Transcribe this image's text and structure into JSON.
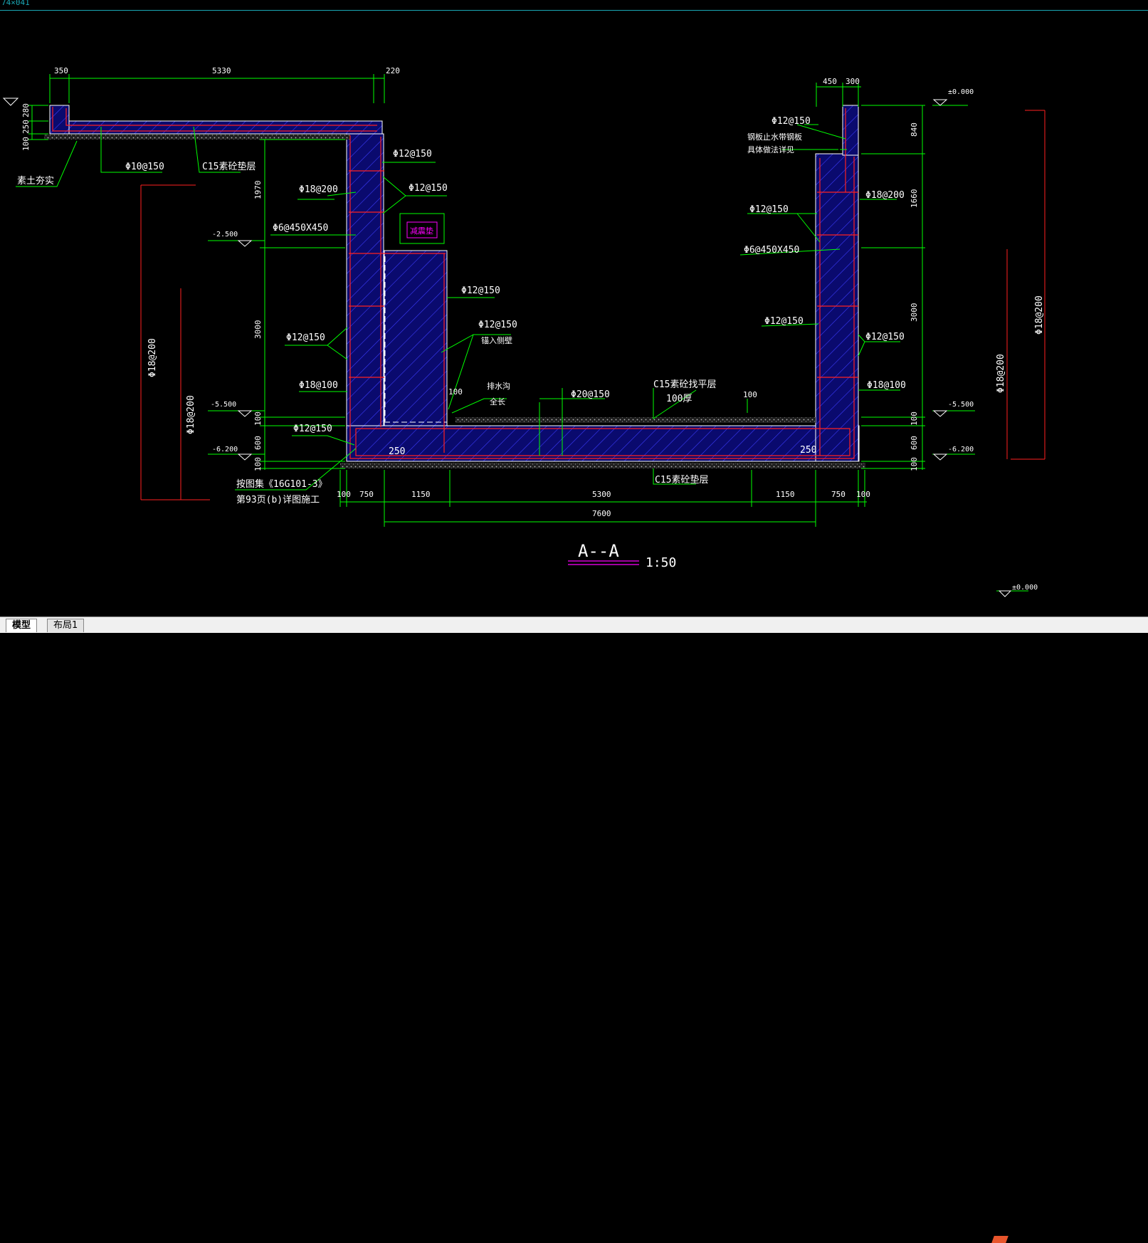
{
  "top_label": "74×041",
  "tabs": {
    "model": "模型",
    "layout": "布局1"
  },
  "section": {
    "title": "A--A",
    "scale": "1:50"
  },
  "dims_top": [
    "350",
    "5330",
    "220"
  ],
  "dims_top_right": [
    "450",
    "300"
  ],
  "dims_bottom": [
    "100",
    "750",
    "1150",
    "5300",
    "1150",
    "750",
    "100"
  ],
  "dim_total": "7600",
  "dims_left_vertical": [
    "280",
    "250",
    "100",
    "1970",
    "3000",
    "100",
    "600",
    "100"
  ],
  "dims_right_vertical": [
    "840",
    "1660",
    "3000",
    "100",
    "600",
    "100"
  ],
  "elevations": {
    "e_neg2500": "-2.500",
    "e_neg5500": "-5.500",
    "e_neg6200": "-6.200",
    "e_zero": "±0.000"
  },
  "labels": {
    "soil": "素土夯实",
    "phi10": "Φ10@150",
    "c15_cushion": "C15素砼垫层",
    "phi12_a": "Φ12@150",
    "phi18_200": "Φ18@200",
    "phi12_b": "Φ12@150",
    "phi6": "Φ6@450X450",
    "pit": "减震垫",
    "phi12_c": "Φ12@150",
    "phi12_d": "Φ12@150",
    "anchor": "锚入侧壁",
    "phi12_e": "Φ12@150",
    "drain": "排水沟",
    "drain2": "全长",
    "phi18_100": "Φ18@100",
    "phi20": "Φ20@150",
    "c15_leveling": "C15素砼找平层",
    "thick100": "100厚",
    "phi12_f": "Φ12@150",
    "note1": "按图集《16G101-3》",
    "note2": "第93页(b)详图施工",
    "c15_bottom": "C15素砼垫层",
    "r_phi12_a": "Φ12@150",
    "r_note1": "钢板止水带钢板",
    "r_note2": "具体做法详见",
    "r_phi18_200": "Φ18@200",
    "r_phi12_b": "Φ12@150",
    "r_phi6": "Φ6@450X450",
    "r_phi12_c": "Φ12@150",
    "r_phi12_d": "Φ12@150",
    "r_phi18_100": "Φ18@100",
    "big_left_1": "Φ18@200",
    "big_left_2": "Φ18@200",
    "big_right_1": "Φ18@200",
    "big_right_2": "Φ18@200",
    "num_250_l": "250",
    "num_250_r": "250",
    "num_100_a": "100",
    "num_100_b": "100"
  },
  "colors": {
    "background": "#000000",
    "dimension": "#00ff00",
    "text": "#ffffff",
    "rebar": "#ff2020",
    "hatch": "#2a2aff",
    "outline": "#ffffff",
    "magenta": "#ff00ff",
    "accent": "#1aa7b5"
  }
}
